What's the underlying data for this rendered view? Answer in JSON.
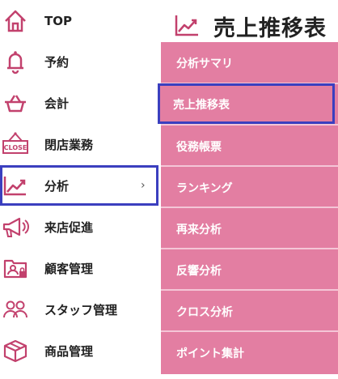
{
  "sidebar": {
    "items": [
      {
        "label": "TOP",
        "icon": "home-icon"
      },
      {
        "label": "予約",
        "icon": "bell-icon"
      },
      {
        "label": "会計",
        "icon": "basket-icon"
      },
      {
        "label": "閉店業務",
        "icon": "close-sign-icon",
        "icon_text": "CLOSE"
      },
      {
        "label": "分析",
        "icon": "chart-line-icon",
        "chevron": "›"
      },
      {
        "label": "来店促進",
        "icon": "megaphone-icon"
      },
      {
        "label": "顧客管理",
        "icon": "customer-card-icon"
      },
      {
        "label": "スタッフ管理",
        "icon": "staff-icon"
      },
      {
        "label": "商品管理",
        "icon": "box-icon"
      }
    ]
  },
  "submenu": {
    "title": "売上推移表",
    "items": [
      {
        "label": "分析サマリ"
      },
      {
        "label": "売上推移表"
      },
      {
        "label": "役務帳票"
      },
      {
        "label": "ランキング"
      },
      {
        "label": "再来分析"
      },
      {
        "label": "反響分析"
      },
      {
        "label": "クロス分析"
      },
      {
        "label": "ポイント集計"
      }
    ]
  },
  "colors": {
    "accent": "#c2416d",
    "panel": "#e37ea2",
    "highlight": "#3b3fbf"
  }
}
